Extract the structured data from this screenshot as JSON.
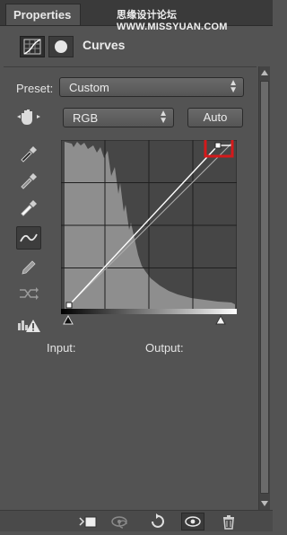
{
  "tab": {
    "label": "Properties"
  },
  "watermark": "思缘设计论坛 WWW.MISSYUAN.COM",
  "header": {
    "title": "Curves",
    "icons": [
      "curves-adjustment-icon",
      "layer-mask-icon"
    ]
  },
  "preset": {
    "label": "Preset:",
    "value": "Custom"
  },
  "channel": {
    "value": "RGB"
  },
  "auto": {
    "label": "Auto"
  },
  "tools": [
    "on-image-adjust-hand-icon",
    "black-point-eyedropper-icon",
    "gray-point-eyedropper-icon",
    "white-point-eyedropper-icon",
    "curve-point-icon",
    "pencil-icon",
    "smooth-icon",
    "clipping-warning-icon"
  ],
  "labels": {
    "input": "Input:",
    "output": "Output:"
  },
  "bottom_toolbar": [
    "clip-to-layer-icon",
    "view-previous-state-icon",
    "reset-icon",
    "toggle-visibility-icon",
    "delete-icon"
  ],
  "colors": {
    "panel_bg": "#535353",
    "highlight": "#d4191b"
  }
}
